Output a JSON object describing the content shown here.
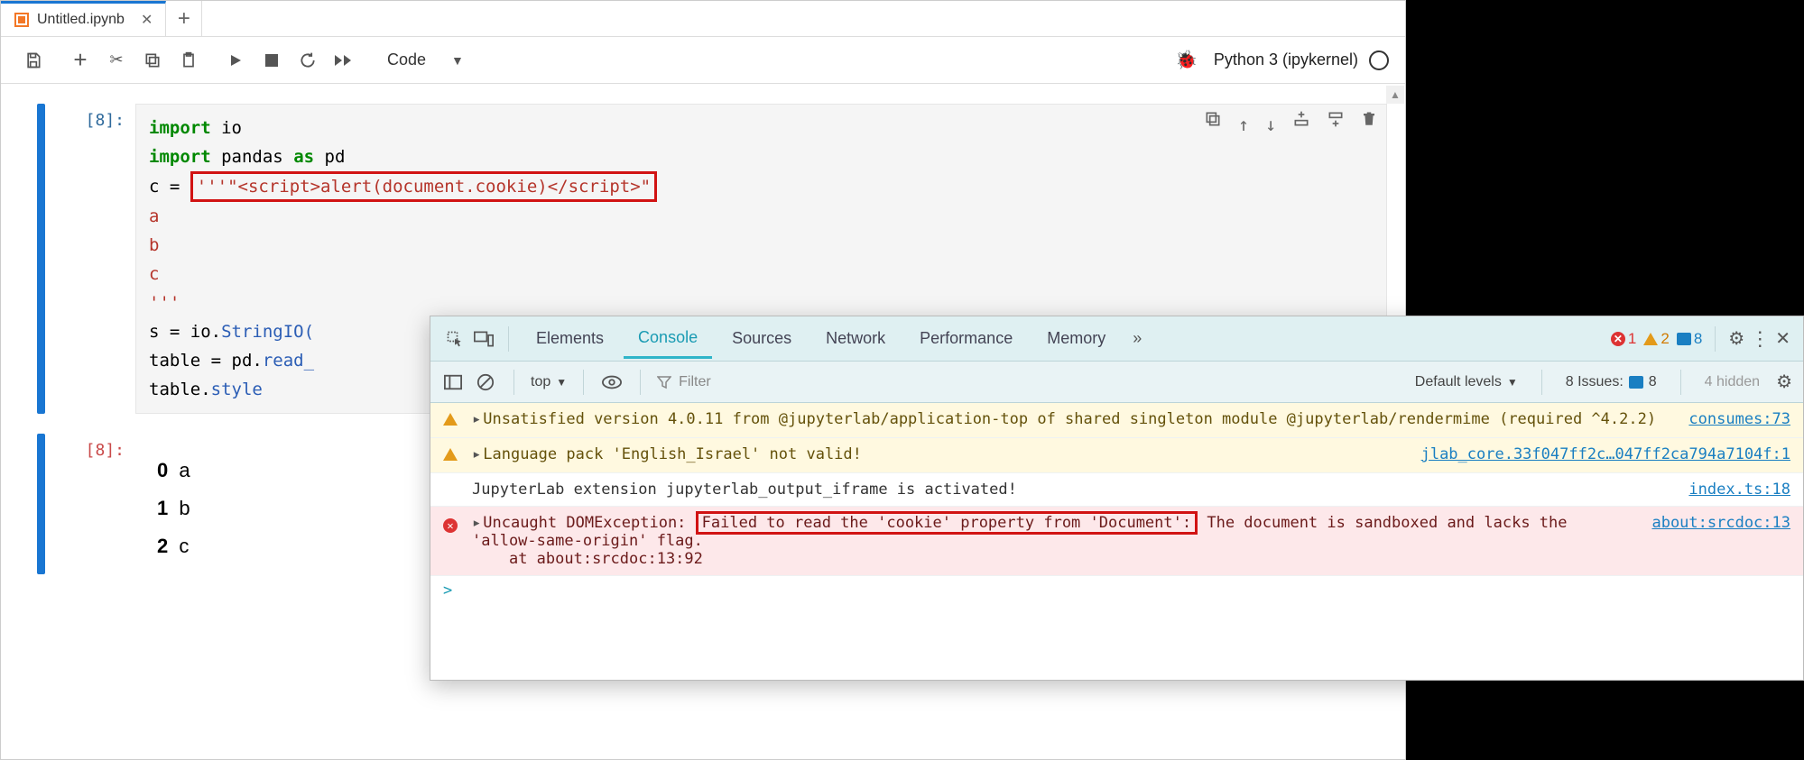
{
  "tab": {
    "title": "Untitled.ipynb"
  },
  "toolbar": {
    "celltype": "Code",
    "kernel": "Python 3 (ipykernel)"
  },
  "cell_in": {
    "prompt": "[8]:",
    "l1a": "import",
    "l1b": "io",
    "l2a": "import",
    "l2b": "pandas",
    "l2c": "as",
    "l2d": "pd",
    "l3a": "c = ",
    "l3b": "'''\"<script>alert(document.cookie)</script>\"",
    "l4": "a",
    "l5": "b",
    "l6": "c",
    "l7": "'''",
    "l8a": "s = io.",
    "l8b": "StringIO(",
    "l9a": "table = pd.",
    "l9b": "read_",
    "l10a": "table.",
    "l10b": "style"
  },
  "cell_out": {
    "prompt": "[8]:",
    "rows": [
      {
        "idx": "0",
        "val": "a"
      },
      {
        "idx": "1",
        "val": "b"
      },
      {
        "idx": "2",
        "val": "c"
      }
    ]
  },
  "devtools": {
    "tabs": {
      "elements": "Elements",
      "console": "Console",
      "sources": "Sources",
      "network": "Network",
      "performance": "Performance",
      "memory": "Memory"
    },
    "counts": {
      "err": "1",
      "warn": "2",
      "msg": "8"
    },
    "filter": {
      "context": "top",
      "placeholder": "Filter",
      "levels": "Default levels",
      "issues_label": "8 Issues:",
      "issues_count": "8",
      "hidden": "4 hidden"
    },
    "msgs": {
      "w1_text": "Unsatisfied version 4.0.11 from @jupyterlab/application-top of shared singleton module @jupyterlab/rendermime (required ^4.2.2)",
      "w1_src": "consumes:73",
      "w2_text": "Language pack 'English_Israel' not valid!",
      "w2_src": "jlab_core.33f047ff2c…047ff2ca794a7104f:1",
      "i1_text": "JupyterLab extension jupyterlab_output_iframe is activated!",
      "i1_src": "index.ts:18",
      "e1_pre": "Uncaught DOMException: ",
      "e1_box": "Failed to read the 'cookie' property from 'Document':",
      "e1_post": " The document is sandboxed and lacks the 'allow-same-origin' flag.\n    at about:srcdoc:13:92",
      "e1_src": "about:srcdoc:13"
    },
    "prompt": ">"
  }
}
